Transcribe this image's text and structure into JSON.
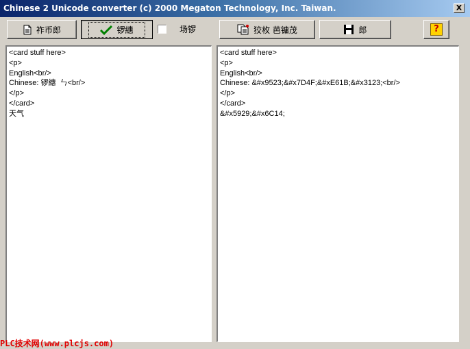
{
  "window": {
    "title": "Chinese 2 Unicode converter  (c) 2000 Megaton Technology, Inc. Taiwan.",
    "close_glyph": "X"
  },
  "toolbar": {
    "open_label": "祚币郎",
    "convert_label": "锣繐",
    "checkbox_label": "场锣",
    "checkbox_checked": false,
    "copy_label": "狡枚  芭镛茂",
    "save_label": "郎",
    "help_glyph": "?"
  },
  "left_pane": {
    "lines": [
      "<card stuff here>",
      "<p>",
      "English<br/>",
      "Chinese: 锣繐  ㄣ<br/>",
      "</p>",
      "</card>",
      "天气"
    ]
  },
  "right_pane": {
    "lines": [
      "<card stuff here>",
      "<p>",
      "English<br/>",
      "Chinese: &#x9523;&#x7D4F;&#xE61B;&#x3123;<br/>",
      "</p>",
      "</card>",
      "&#x5929;&#x6C14;"
    ]
  },
  "watermark": "PLC技术网(www.plcjs.com)",
  "colors": {
    "title_gradient_start": "#0a246a",
    "title_gradient_end": "#a6caf0",
    "checkmark": "#008000",
    "help_icon": "#ffd200",
    "watermark": "#e00000"
  }
}
